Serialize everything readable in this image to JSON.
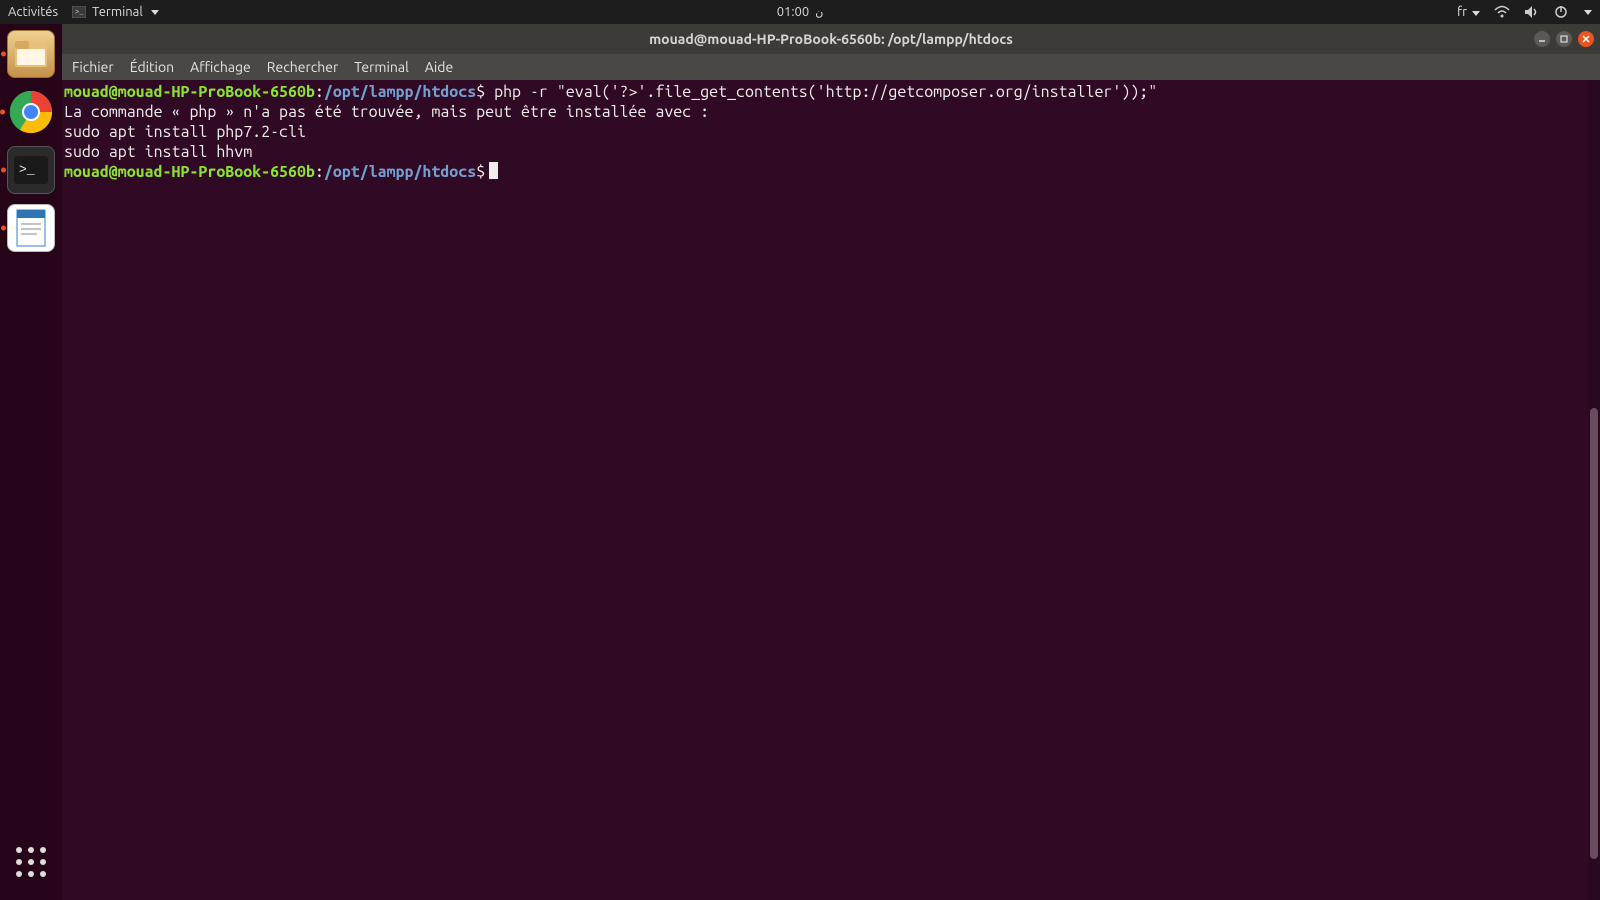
{
  "topbar": {
    "activities": "Activités",
    "app_name": "Terminal",
    "clock": "01:00",
    "lang": "fr"
  },
  "dock": {
    "items": [
      {
        "name": "files-app-icon",
        "running": true
      },
      {
        "name": "chrome-app-icon",
        "running": true
      },
      {
        "name": "terminal-app-icon",
        "running": true,
        "active": true
      },
      {
        "name": "writer-app-icon",
        "running": true
      }
    ]
  },
  "window": {
    "title": "mouad@mouad-HP-ProBook-6560b: /opt/lampp/htdocs"
  },
  "menu": {
    "items": [
      "Fichier",
      "Édition",
      "Affichage",
      "Rechercher",
      "Terminal",
      "Aide"
    ]
  },
  "prompt": {
    "user_host": "mouad@mouad-HP-ProBook-6560b",
    "path": "/opt/lampp/htdocs",
    "sep_colon": ":",
    "dollar": "$"
  },
  "terminal": {
    "command1": " php -r \"eval('?>'.file_get_contents('http://getcomposer.org/installer'));\"",
    "blank": "",
    "err_line": "La commande « php » n'a pas été trouvée, mais peut être installée avec :",
    "suggest1": "sudo apt install php7.2-cli",
    "suggest2": "sudo apt install hhvm"
  }
}
